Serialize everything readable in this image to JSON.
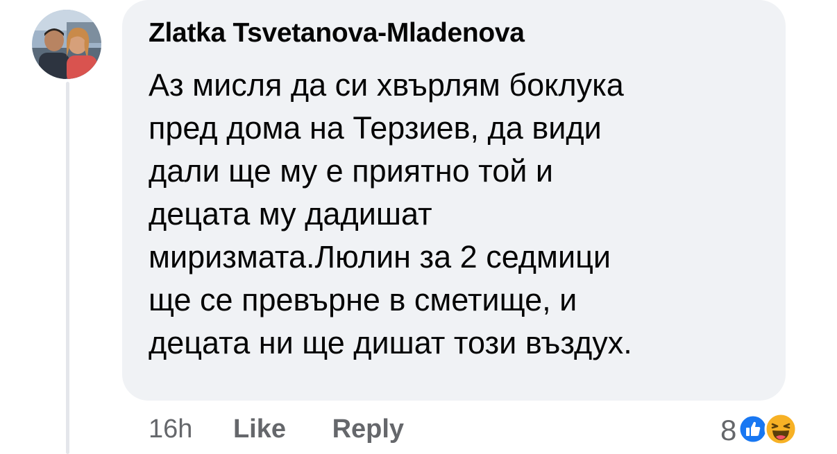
{
  "comment": {
    "author": "Zlatka Tsvetanova-Mladenova",
    "text_lines": [
      "Аз мисля да си хвърлям боклука",
      "пред дома на Терзиев, да види",
      "дали ще му е приятно той и",
      "децата му дадишат",
      "миризмата.Люлин за 2 седмици",
      "ще се превърне в сметище, и",
      "децата ни ще дишат този въздух."
    ],
    "timestamp": "16h",
    "like_label": "Like",
    "reply_label": "Reply",
    "reaction_count": "8",
    "reactions": [
      "like-icon",
      "haha-icon"
    ]
  },
  "colors": {
    "bubble": "#f0f2f5",
    "like_blue": "#1877f2",
    "haha_yellow": "#f7b125",
    "secondary_text": "#65676b"
  }
}
